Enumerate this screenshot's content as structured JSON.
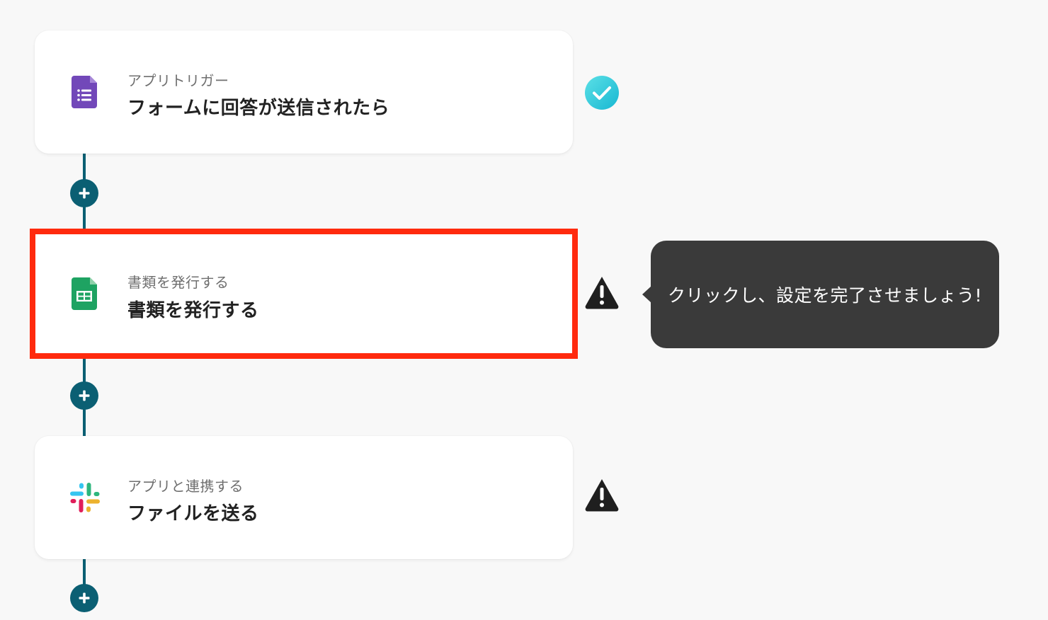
{
  "steps": [
    {
      "kind": "アプリトリガー",
      "title": "フォームに回答が送信されたら",
      "app_icon": "google-forms-icon",
      "status": "complete"
    },
    {
      "kind": "書類を発行する",
      "title": "書類を発行する",
      "app_icon": "google-sheets-icon",
      "status": "warning",
      "highlighted": true
    },
    {
      "kind": "アプリと連携する",
      "title": "ファイルを送る",
      "app_icon": "slack-icon",
      "status": "warning"
    }
  ],
  "tooltip": {
    "text": "クリックし、設定を完了させましょう!"
  },
  "colors": {
    "accent": "#0b5f73",
    "highlight": "#ff2a0e",
    "complete_gradient_start": "#5be0e6",
    "complete_gradient_end": "#18b7d2",
    "warning": "#1f1f1f",
    "tooltip_bg": "#3a3a3a"
  },
  "icons": {
    "add": "plus-icon",
    "complete": "check-circle-icon",
    "warning": "warning-triangle-icon"
  }
}
